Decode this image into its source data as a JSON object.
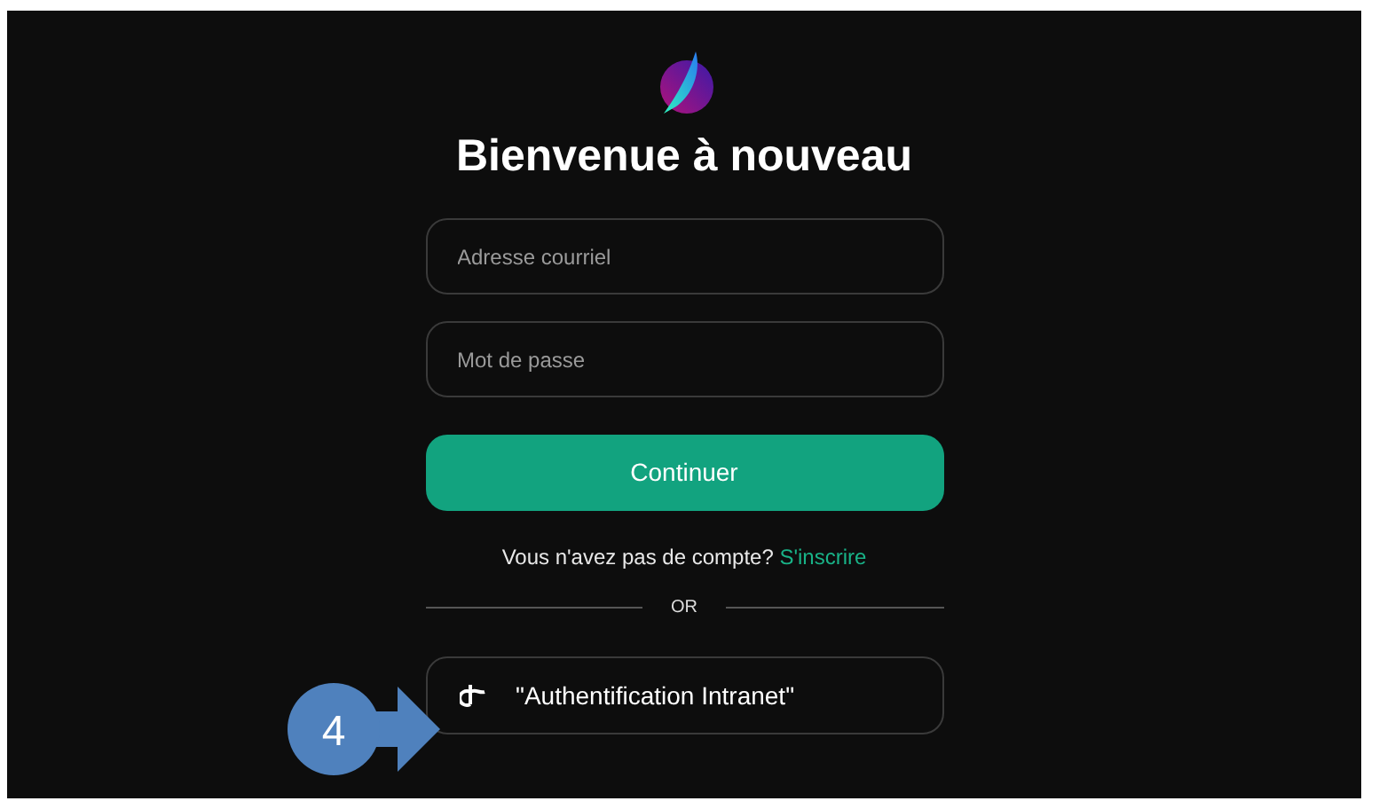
{
  "title": "Bienvenue à nouveau",
  "fields": [
    {
      "placeholder": "Adresse courriel"
    },
    {
      "placeholder": "Mot de passe"
    }
  ],
  "continue_button": "Continuer",
  "signup": {
    "text": "Vous n'avez pas de compte?",
    "link": "S'inscrire"
  },
  "divider": "OR",
  "sso_button": "\"Authentification Intranet\"",
  "callout": {
    "number": "4"
  }
}
